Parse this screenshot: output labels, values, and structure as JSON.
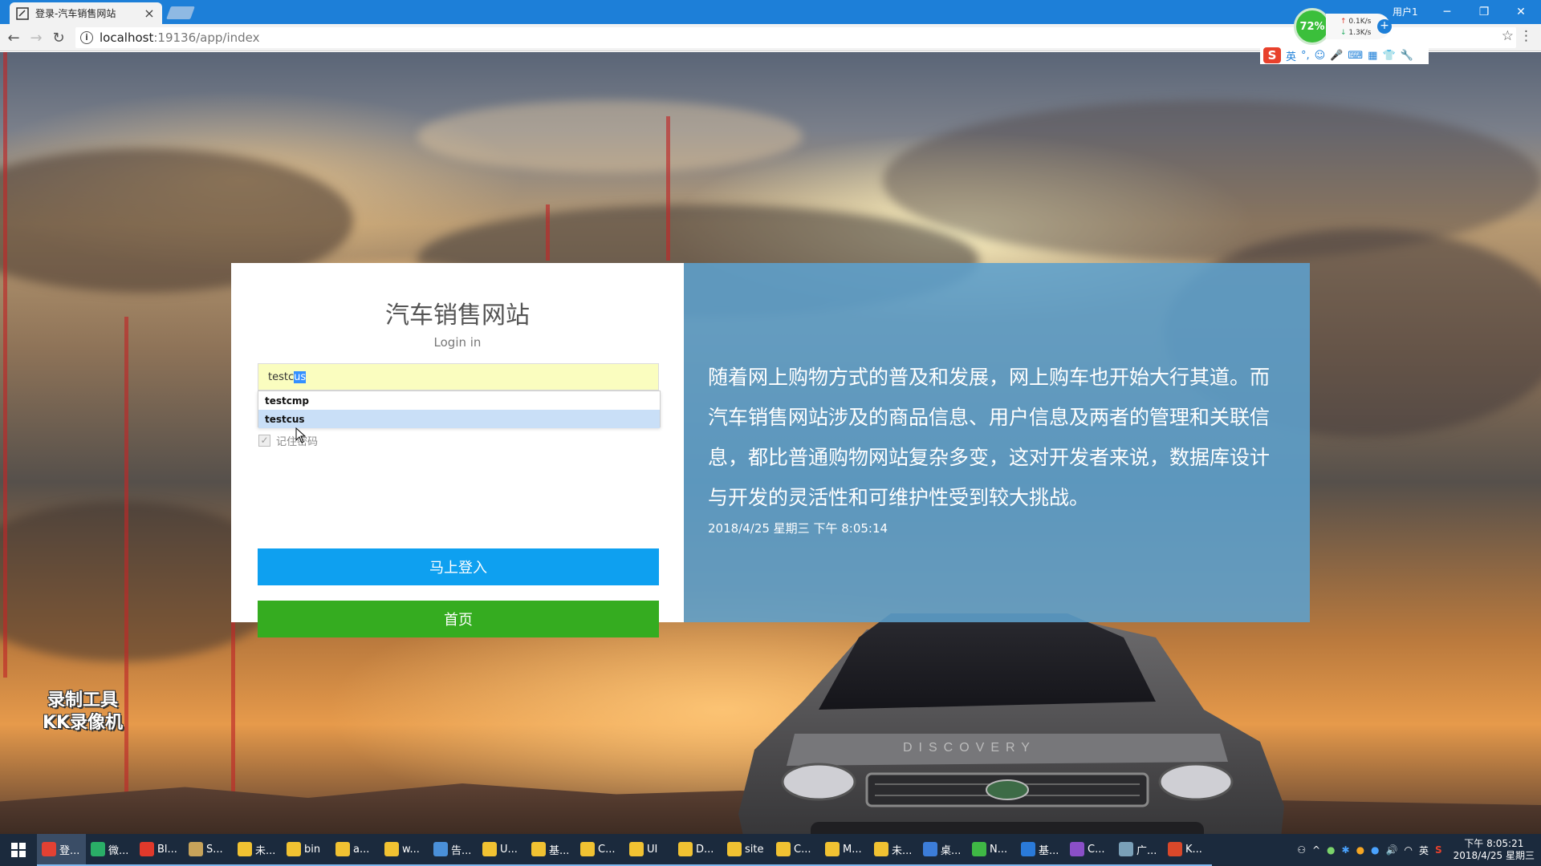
{
  "browser": {
    "tab_title": "登录-汽车销售网站",
    "tab_close": "×",
    "user_label": "用户1",
    "url_host": "localhost",
    "url_rest": ":19136/app/index",
    "url_info": "i",
    "net_percent": "72%",
    "net_up": "0.1K/s",
    "net_down": "1.3K/s",
    "ime_mode": "英"
  },
  "login": {
    "title": "汽车销售网站",
    "subtitle": "Login in",
    "username_typed": "testc",
    "username_selected": "us",
    "autocomplete": [
      "testcmp",
      "testcus"
    ],
    "remember_label": "记住密码",
    "login_button": "马上登入",
    "home_button": "首页"
  },
  "info": {
    "paragraph": "随着网上购物方式的普及和发展，网上购车也开始大行其道。而汽车销售网站涉及的商品信息、用户信息及两者的管理和关联信息，都比普通购物网站复杂多变，这对开发者来说，数据库设计与开发的灵活性和可维护性受到较大挑战。",
    "datetime": "2018/4/25 星期三 下午 8:05:14"
  },
  "watermark": {
    "line1": "录制工具",
    "line2": "KK录像机"
  },
  "taskbar": {
    "items": [
      {
        "label": "登...",
        "color": "#e34133"
      },
      {
        "label": "微...",
        "color": "#2aae67"
      },
      {
        "label": "Bl...",
        "color": "#e0392b"
      },
      {
        "label": "S...",
        "color": "#c7a35a"
      },
      {
        "label": "未...",
        "color": "#f1c232"
      },
      {
        "label": "bin",
        "color": "#f1c232"
      },
      {
        "label": "a...",
        "color": "#f1c232"
      },
      {
        "label": "w...",
        "color": "#f1c232"
      },
      {
        "label": "告...",
        "color": "#4a90d9"
      },
      {
        "label": "U...",
        "color": "#f1c232"
      },
      {
        "label": "基...",
        "color": "#f1c232"
      },
      {
        "label": "C...",
        "color": "#f1c232"
      },
      {
        "label": "UI",
        "color": "#f1c232"
      },
      {
        "label": "D...",
        "color": "#f1c232"
      },
      {
        "label": "site",
        "color": "#f1c232"
      },
      {
        "label": "C...",
        "color": "#f1c232"
      },
      {
        "label": "M...",
        "color": "#f1c232"
      },
      {
        "label": "未...",
        "color": "#f1c232"
      },
      {
        "label": "桌...",
        "color": "#3c7dd9"
      },
      {
        "label": "N...",
        "color": "#3fb845"
      },
      {
        "label": "基...",
        "color": "#2a7ad9"
      },
      {
        "label": "C...",
        "color": "#8a4fc7"
      },
      {
        "label": "广...",
        "color": "#7aa0b8"
      },
      {
        "label": "K...",
        "color": "#d9482a"
      }
    ],
    "tray_ime": "英",
    "clock_time": "下午 8:05:21",
    "clock_date": "2018/4/25 星期三"
  }
}
